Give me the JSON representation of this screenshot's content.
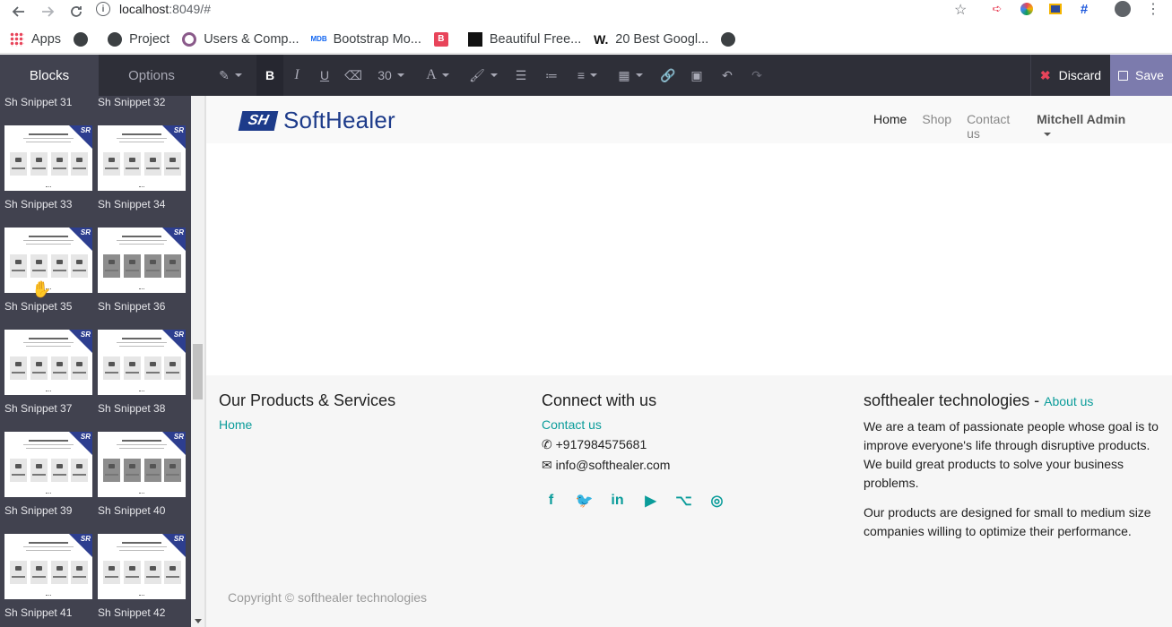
{
  "browser": {
    "url_host": "localhost",
    "url_path": ":8049/#",
    "bookmarks": [
      {
        "label": "Apps",
        "icon": "apps-grid-icon"
      },
      {
        "label": "",
        "icon": "globe-icon"
      },
      {
        "label": "Project",
        "icon": "globe-icon"
      },
      {
        "label": "Users & Comp...",
        "icon": "odoo-icon"
      },
      {
        "label": "Bootstrap Mo...",
        "icon": "mdb-icon"
      },
      {
        "label": "",
        "icon": "b-icon"
      },
      {
        "label": "Beautiful Free...",
        "icon": "unsplash-icon"
      },
      {
        "label": "20 Best Googl...",
        "icon": "w-icon"
      },
      {
        "label": "",
        "icon": "globe-icon"
      }
    ]
  },
  "editor": {
    "tab_blocks": "Blocks",
    "tab_options": "Options",
    "font_size": "30",
    "discard_label": "Discard",
    "save_label": "Save"
  },
  "snippets": [
    {
      "label": "Sh Snippet 31"
    },
    {
      "label": "Sh Snippet 32"
    },
    {
      "label": "Sh Snippet 33"
    },
    {
      "label": "Sh Snippet 34"
    },
    {
      "label": "Sh Snippet 35"
    },
    {
      "label": "Sh Snippet 36"
    },
    {
      "label": "Sh Snippet 37"
    },
    {
      "label": "Sh Snippet 38"
    },
    {
      "label": "Sh Snippet 39"
    },
    {
      "label": "Sh Snippet 40"
    },
    {
      "label": "Sh Snippet 41"
    },
    {
      "label": "Sh Snippet 42"
    }
  ],
  "site": {
    "logo_mark": "SH",
    "logo_text": "SoftHealer",
    "menu": {
      "home": "Home",
      "shop": "Shop",
      "contact": "Contact us",
      "admin": "Mitchell Admin"
    },
    "footer": {
      "col1_title": "Our Products & Services",
      "col1_link": "Home",
      "col2_title": "Connect with us",
      "col2_link": "Contact us",
      "phone": "+917984575681",
      "email": "info@softhealer.com",
      "col3_title": "softhealer technologies",
      "col3_sep": "-",
      "col3_link": "About us",
      "about_p1": "We are a team of passionate people whose goal is to improve everyone's life through disruptive products. We build great products to solve your business problems.",
      "about_p2": "Our products are designed for small to medium size companies willing to optimize their performance.",
      "copyright": "Copyright © softhealer technologies"
    }
  },
  "colors": {
    "accent": "#0a9c9a",
    "brand": "#1d3b8a",
    "save": "#7c7bad",
    "discard": "#e8445a"
  }
}
